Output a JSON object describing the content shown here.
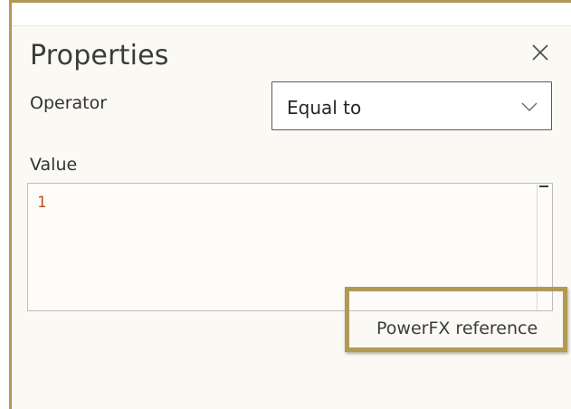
{
  "panel": {
    "title": "Properties",
    "close_icon": "close-icon"
  },
  "operator": {
    "label": "Operator",
    "selected": "Equal to",
    "chevron_icon": "chevron-down-icon"
  },
  "value": {
    "label": "Value",
    "code": "1"
  },
  "reference": {
    "link_text": "PowerFX reference"
  },
  "colors": {
    "highlight_border": "#b09a55",
    "code_number": "#b5521b",
    "panel_background": "#fbf9f3"
  }
}
